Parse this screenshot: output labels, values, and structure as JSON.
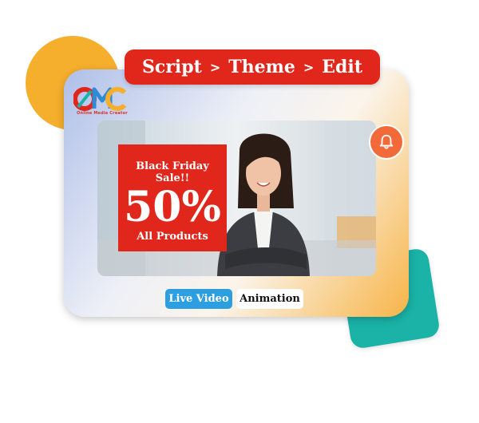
{
  "breadcrumb": {
    "items": [
      "Script",
      "Theme",
      "Edit"
    ],
    "separator": ">"
  },
  "logo": {
    "wordmark": "OMC",
    "subtitle": "Online Media Creator"
  },
  "promo": {
    "headline": "Black Friday Sale!!",
    "discount": "50%",
    "subline": "All Products"
  },
  "tabs": [
    {
      "label": "Live Video",
      "active": true
    },
    {
      "label": "Animation",
      "active": false
    }
  ],
  "icons": {
    "notify": "bell-icon"
  },
  "colors": {
    "brand_red": "#e1261c",
    "accent_orange": "#f26a3a",
    "accent_yellow": "#f6ae2d",
    "accent_teal": "#1bb2a7",
    "tab_blue": "#2d9fe0"
  }
}
